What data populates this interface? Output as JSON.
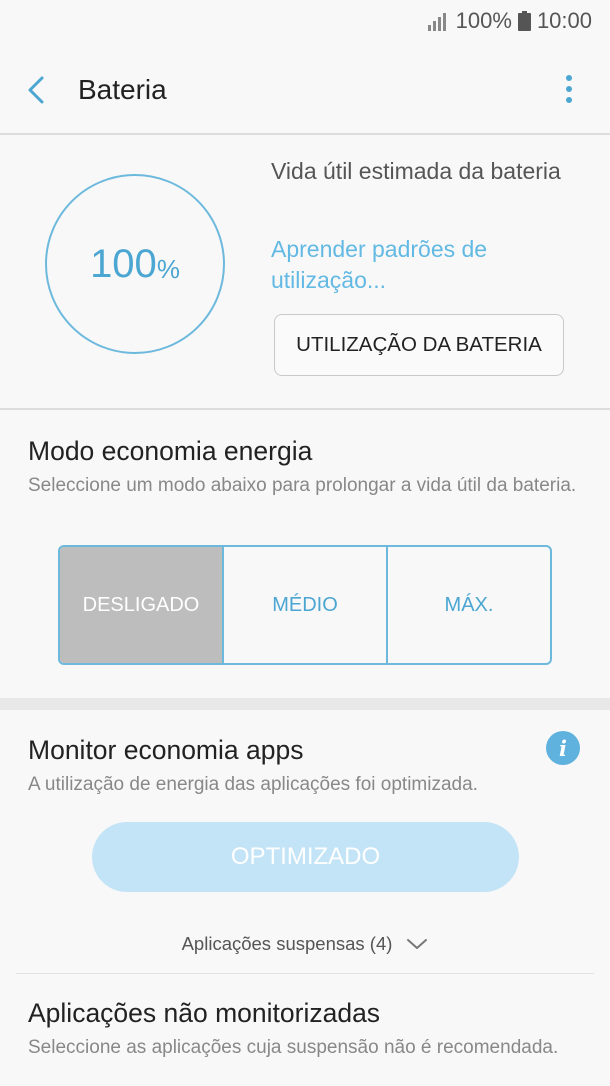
{
  "status_bar": {
    "battery_percent": "100%",
    "time": "10:00",
    "icons": [
      "signal-icon",
      "battery-icon"
    ]
  },
  "app_bar": {
    "title": "Bateria",
    "back_icon": "chevron-left-icon",
    "more_icon": "more-vert-icon"
  },
  "battery": {
    "percent_value": "100",
    "percent_sign": "%",
    "estimated_label": "Vida útil estimada da bateria",
    "learn_link": "Aprender padrões de utilização...",
    "usage_button": "UTILIZAÇÃO DA BATERIA"
  },
  "power_saving": {
    "title": "Modo economia energia",
    "description": "Seleccione um modo abaixo para prolongar a vida útil da bateria.",
    "modes": [
      "DESLIGADO",
      "MÉDIO",
      "MÁX."
    ],
    "selected_mode": "DESLIGADO"
  },
  "app_monitor": {
    "title": "Monitor economia apps",
    "info_icon": "i",
    "description": "A utilização de energia das aplicações foi optimizada.",
    "optimized_button": "OPTIMIZADO",
    "suspended_apps": "Aplicações suspensas (4)"
  },
  "unmonitored": {
    "title": "Aplicações não monitorizadas",
    "description": "Seleccione as aplicações cuja suspensão não é recomendada."
  },
  "colors": {
    "accent": "#4ba6d2",
    "selected_segment": "#bdbdbd",
    "optimized_button": "#c3e4f7"
  }
}
